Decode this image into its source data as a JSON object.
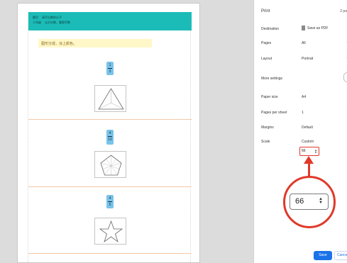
{
  "preview": {
    "header_row1_label": "题目",
    "header_row1_value": "请写分数的分子",
    "header_row2_label": "二年级",
    "header_row2_value": "认识分数，看图写数",
    "hint_text": "图形分成，涂上颜色。",
    "fractions": [
      {
        "numerator": "1",
        "denominator": "3",
        "shape": "triangle"
      },
      {
        "numerator": "4",
        "denominator": "10",
        "shape": "pentagon"
      },
      {
        "numerator": "4",
        "denominator": "5",
        "shape": "star"
      }
    ]
  },
  "print_panel": {
    "title": "Print",
    "sheets": "2 pa",
    "destination_label": "Destination",
    "destination_value": "Save as PDF",
    "pages_label": "Pages",
    "pages_value": "All",
    "layout_label": "Layout",
    "layout_value": "Portrait",
    "more_settings_label": "More settings",
    "paper_size_label": "Paper size",
    "paper_size_value": "A4",
    "pages_per_sheet_label": "Pages per sheet",
    "pages_per_sheet_value": "1",
    "margins_label": "Margins",
    "margins_value": "Default",
    "scale_label": "Scale",
    "scale_value": "Custom",
    "scale_input_value": "66",
    "zoomed_scale_value": "66",
    "save_label": "Save",
    "cancel_label": "Cancel"
  },
  "colors": {
    "accent_red": "#e0392b",
    "header_teal": "#1bbcb7",
    "badge_blue": "#79c3e8",
    "button_blue": "#1a73e8"
  }
}
